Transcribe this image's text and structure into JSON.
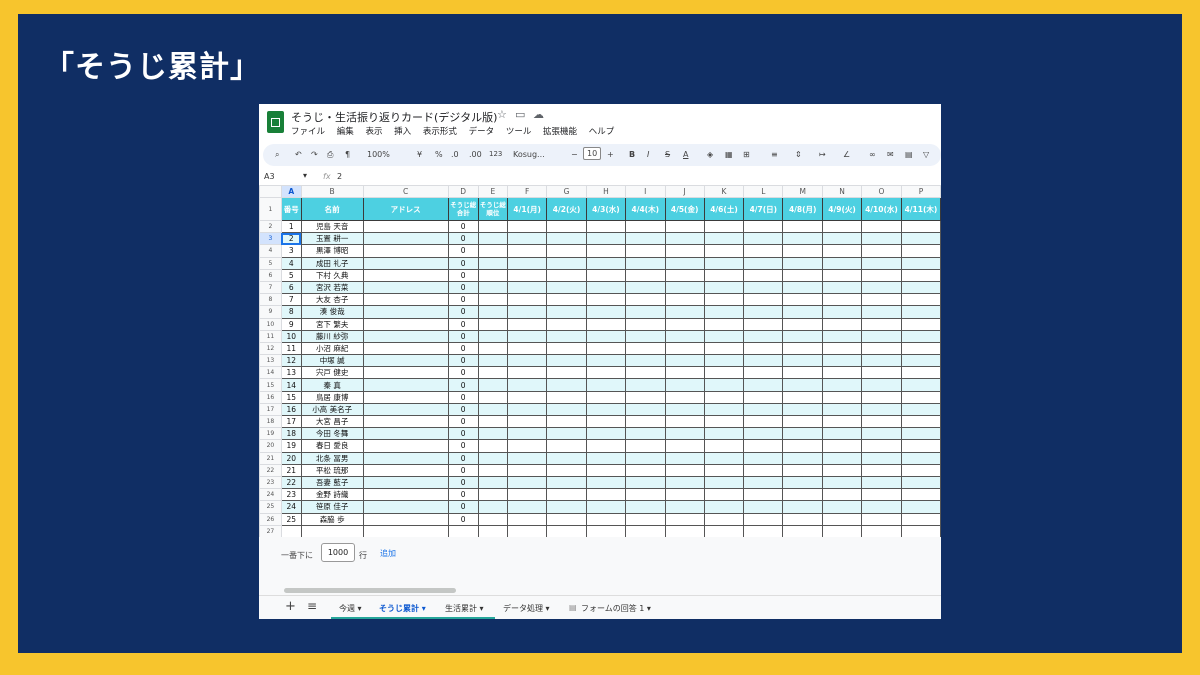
{
  "slide": {
    "title": "「そうじ累計」"
  },
  "doc": {
    "title": "そうじ・生活振り返りカード(デジタル版)",
    "menus": [
      "ファイル",
      "編集",
      "表示",
      "挿入",
      "表示形式",
      "データ",
      "ツール",
      "拡張機能",
      "ヘルプ"
    ]
  },
  "toolbar": {
    "zoom": "100%",
    "currency": "¥",
    "percent": "%",
    "dec_dec": ".0",
    "dec_inc": ".00",
    "num_format": "123",
    "font": "Kosug...",
    "font_size": "10",
    "bold": "B",
    "italic": "I",
    "strike": "S",
    "text_color": "A"
  },
  "formula_bar": {
    "cell_ref": "A3",
    "fx": "fx",
    "value": "2"
  },
  "columns": [
    "A",
    "B",
    "C",
    "D",
    "E",
    "F",
    "G",
    "H",
    "I",
    "J",
    "K",
    "L",
    "M",
    "N",
    "O",
    "P"
  ],
  "header_labels": [
    "番号",
    "名前",
    "アドレス",
    "そうじ総合計",
    "そうじ総順位",
    "4/1(月)",
    "4/2(火)",
    "4/3(水)",
    "4/4(木)",
    "4/5(金)",
    "4/6(土)",
    "4/7(日)",
    "4/8(月)",
    "4/9(火)",
    "4/10(水)",
    "4/11(木)"
  ],
  "rows": [
    {
      "n": "1",
      "name": "児島 天音",
      "total": "0"
    },
    {
      "n": "2",
      "name": "玉置 耕一",
      "total": "0"
    },
    {
      "n": "3",
      "name": "黒澤 博昭",
      "total": "0"
    },
    {
      "n": "4",
      "name": "成田 礼子",
      "total": "0"
    },
    {
      "n": "5",
      "name": "下村 久典",
      "total": "0"
    },
    {
      "n": "6",
      "name": "宮沢 若菜",
      "total": "0"
    },
    {
      "n": "7",
      "name": "大友 杏子",
      "total": "0"
    },
    {
      "n": "8",
      "name": "湊 俊哉",
      "total": "0"
    },
    {
      "n": "9",
      "name": "宮下 繁夫",
      "total": "0"
    },
    {
      "n": "10",
      "name": "藤川 紗弥",
      "total": "0"
    },
    {
      "n": "11",
      "name": "小沼 麻紀",
      "total": "0"
    },
    {
      "n": "12",
      "name": "中塚 誠",
      "total": "0"
    },
    {
      "n": "13",
      "name": "宍戸 健史",
      "total": "0"
    },
    {
      "n": "14",
      "name": "秦 真",
      "total": "0"
    },
    {
      "n": "15",
      "name": "鳥居 康博",
      "total": "0"
    },
    {
      "n": "16",
      "name": "小高 美名子",
      "total": "0"
    },
    {
      "n": "17",
      "name": "大宮 昌子",
      "total": "0"
    },
    {
      "n": "18",
      "name": "今田 冬舞",
      "total": "0"
    },
    {
      "n": "19",
      "name": "春日 愛良",
      "total": "0"
    },
    {
      "n": "20",
      "name": "北条 冨男",
      "total": "0"
    },
    {
      "n": "21",
      "name": "平松 琉那",
      "total": "0"
    },
    {
      "n": "22",
      "name": "吾妻 藍子",
      "total": "0"
    },
    {
      "n": "23",
      "name": "金野 詩織",
      "total": "0"
    },
    {
      "n": "24",
      "name": "笹原 佳子",
      "total": "0"
    },
    {
      "n": "25",
      "name": "森脇 歩",
      "total": "0"
    }
  ],
  "add_rows": {
    "label": "一番下に",
    "count": "1000",
    "unit": "行",
    "button": "追加"
  },
  "tabs": [
    {
      "label": "今週 ▾"
    },
    {
      "label": "そうじ累計 ▾",
      "active": true
    },
    {
      "label": "生活累計 ▾"
    },
    {
      "label": "データ処理 ▾"
    },
    {
      "label": "フォームの回答 1 ▾"
    }
  ],
  "colors": {
    "header": "#4dd0e1",
    "band": "#e0f7fa",
    "frame": "#102e64",
    "border": "#f7c52d"
  }
}
